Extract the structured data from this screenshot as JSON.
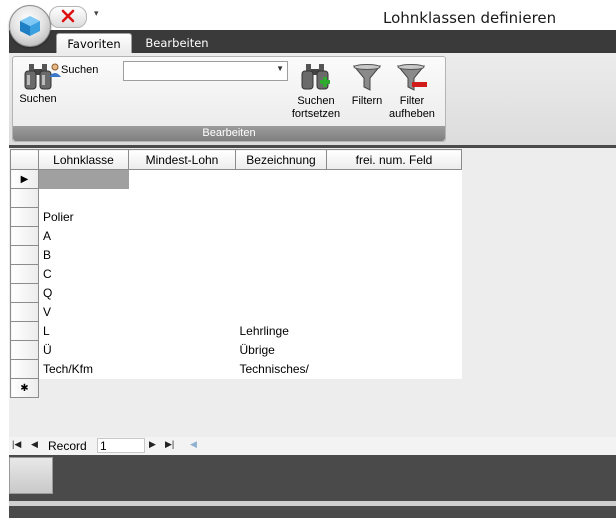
{
  "window": {
    "title": "Lohnklassen definieren"
  },
  "quick_access": {
    "more_glyph": "▾"
  },
  "ribbon": {
    "tabs": [
      {
        "label": "Favoriten",
        "active": true
      },
      {
        "label": "Bearbeiten",
        "active": false
      }
    ],
    "group_label": "Bearbeiten",
    "search_button": "Suchen",
    "search_field_label": "Suchen",
    "search_field_value": "",
    "continue_search": [
      "Suchen",
      "fortsetzen"
    ],
    "filter_button": "Filtern",
    "remove_filter": [
      "Filter",
      "aufheben"
    ]
  },
  "grid": {
    "columns": [
      "Lohnklasse",
      "Mindest-Lohn",
      "Bezeichnung",
      "frei. num. Feld"
    ],
    "rows": [
      [
        "",
        "",
        "",
        ""
      ],
      [
        "",
        "",
        "",
        ""
      ],
      [
        "Polier",
        "",
        "",
        ""
      ],
      [
        "A",
        "",
        "",
        ""
      ],
      [
        "B",
        "",
        "",
        ""
      ],
      [
        "C",
        "",
        "",
        ""
      ],
      [
        "Q",
        "",
        "",
        ""
      ],
      [
        "V",
        "",
        "",
        ""
      ],
      [
        "L",
        "",
        "Lehrlinge",
        ""
      ],
      [
        "Ü",
        "",
        "Übrige",
        ""
      ],
      [
        "Tech/Kfm",
        "",
        "Technisches/",
        ""
      ]
    ],
    "current_row_marker": "▶",
    "new_row_marker": "✱"
  },
  "navigator": {
    "label": "Record",
    "value": "1",
    "first_glyph": "|◀",
    "prev_glyph": "◀",
    "next_glyph": "▶",
    "last_glyph": "▶|",
    "new_glyph": "◀"
  },
  "colors": {
    "accent_dark": "#3a3a3a",
    "selection": "#a0a0a0"
  }
}
